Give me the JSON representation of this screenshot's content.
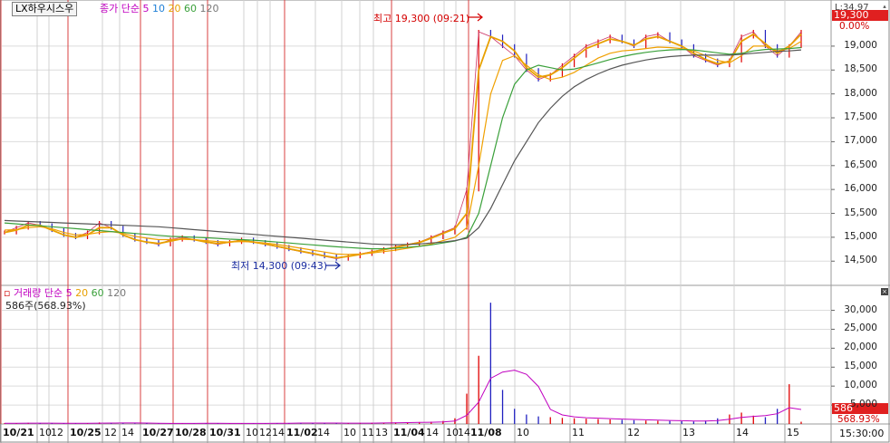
{
  "stock_name": "LX하우시스우",
  "price_legend": {
    "label": "종가 단순",
    "ma": [
      "5",
      "10",
      "20",
      "60",
      "120"
    ]
  },
  "volume_legend": {
    "label": "거래량 단순",
    "ma": [
      "5",
      "20",
      "60",
      "120"
    ],
    "value": "586주(568.93%)"
  },
  "annotations": {
    "high": "최고 19,300 (09:21)",
    "low": "최저 14,300 (09:43)"
  },
  "price_axis": [
    "19,000",
    "18,500",
    "18,000",
    "17,500",
    "17,000",
    "16,500",
    "16,000",
    "15,500",
    "15,000",
    "14,500"
  ],
  "price_axis_top": "L:34.97",
  "price_tag": "19,300",
  "price_change": "0.00%",
  "volume_axis": [
    "30,000",
    "25,000",
    "20,000",
    "15,000",
    "10,000",
    "5,000"
  ],
  "volume_tag": "586",
  "volume_pct": "568.93%",
  "time_label": "15:30:00",
  "dates": [
    {
      "t": "10/21",
      "bold": true
    },
    {
      "t": "10",
      "bold": false
    },
    {
      "t": "12",
      "bold": false
    },
    {
      "t": "10/25",
      "bold": true
    },
    {
      "t": "12",
      "bold": false
    },
    {
      "t": "14",
      "bold": false
    },
    {
      "t": "10/27",
      "bold": true
    },
    {
      "t": "10/28",
      "bold": true
    },
    {
      "t": "10/31",
      "bold": true
    },
    {
      "t": "10",
      "bold": false
    },
    {
      "t": "12",
      "bold": false
    },
    {
      "t": "14",
      "bold": false
    },
    {
      "t": "11/02",
      "bold": true
    },
    {
      "t": "14",
      "bold": false
    },
    {
      "t": "10",
      "bold": false
    },
    {
      "t": "11",
      "bold": false
    },
    {
      "t": "13",
      "bold": false
    },
    {
      "t": "11/04",
      "bold": true
    },
    {
      "t": "14",
      "bold": false
    },
    {
      "t": "10",
      "bold": false
    },
    {
      "t": "14",
      "bold": false
    },
    {
      "t": "11/08",
      "bold": true
    },
    {
      "t": "10",
      "bold": false
    },
    {
      "t": "11",
      "bold": false
    },
    {
      "t": "12",
      "bold": false
    },
    {
      "t": "13",
      "bold": false
    },
    {
      "t": "14",
      "bold": false
    },
    {
      "t": "15",
      "bold": false
    }
  ],
  "colors": {
    "ma5": "#e8a000",
    "ma10": "#1e7fd6",
    "ma20": "#f0a000",
    "ma60": "#3aa03a",
    "ma120": "#555555",
    "legend_ma5": "#c000c0",
    "up": "#e00000",
    "down": "#2020c0",
    "tag": "#e02020",
    "grid_red": "#d84040"
  },
  "chart_data": {
    "type": "line",
    "series": [
      {
        "name": "종가",
        "y": [
          15100,
          15200,
          15300,
          15250,
          15150,
          15050,
          15000,
          15100,
          15300,
          15200,
          15050,
          14950,
          14900,
          14850,
          14950,
          15000,
          14950,
          14900,
          14850,
          14900,
          14950,
          14900,
          14850,
          14800,
          14750,
          14700,
          14650,
          14600,
          14550,
          14600,
          14650,
          14700,
          14750,
          14800,
          14850,
          14900,
          15000,
          15100,
          15200,
          16000,
          19300,
          19200,
          19000,
          18800,
          18500,
          18300,
          18400,
          18600,
          18800,
          19000,
          19100,
          19200,
          19100,
          19000,
          19200,
          19250,
          19100,
          19000,
          18800,
          18700,
          18600,
          18700,
          19200,
          19300,
          19000,
          18800,
          19000,
          19300
        ]
      },
      {
        "name": "5",
        "y": [
          15100,
          15150,
          15250,
          15250,
          15150,
          15050,
          15000,
          15050,
          15200,
          15200,
          15050,
          14950,
          14900,
          14870,
          14920,
          14970,
          14950,
          14900,
          14870,
          14900,
          14930,
          14900,
          14860,
          14810,
          14760,
          14710,
          14660,
          14610,
          14570,
          14600,
          14640,
          14690,
          14740,
          14790,
          14840,
          14890,
          14980,
          15080,
          15180,
          15500,
          18500,
          19200,
          19100,
          18900,
          18550,
          18350,
          18400,
          18550,
          18750,
          18950,
          19050,
          19150,
          19100,
          19020,
          19150,
          19200,
          19100,
          19000,
          18850,
          18720,
          18630,
          18680,
          19100,
          19250,
          19050,
          18850,
          19000,
          19250
        ]
      },
      {
        "name": "20",
        "y": [
          15150,
          15160,
          15200,
          15220,
          15180,
          15100,
          15050,
          15060,
          15100,
          15120,
          15080,
          15020,
          14980,
          14950,
          14950,
          14960,
          14950,
          14930,
          14910,
          14900,
          14910,
          14900,
          14880,
          14850,
          14810,
          14770,
          14730,
          14690,
          14650,
          14640,
          14650,
          14670,
          14700,
          14730,
          14770,
          14810,
          14860,
          14930,
          15000,
          15200,
          16500,
          18000,
          18700,
          18800,
          18600,
          18400,
          18300,
          18350,
          18450,
          18600,
          18750,
          18850,
          18900,
          18920,
          18950,
          18980,
          18970,
          18950,
          18900,
          18800,
          18700,
          18650,
          18800,
          19000,
          19000,
          18900,
          18950,
          19100
        ]
      },
      {
        "name": "60",
        "y": [
          15300,
          15280,
          15260,
          15240,
          15220,
          15200,
          15180,
          15160,
          15140,
          15120,
          15100,
          15080,
          15060,
          15040,
          15020,
          15010,
          15000,
          14990,
          14975,
          14960,
          14950,
          14940,
          14920,
          14900,
          14880,
          14860,
          14840,
          14820,
          14800,
          14785,
          14770,
          14760,
          14760,
          14770,
          14790,
          14810,
          14840,
          14880,
          14920,
          15000,
          15500,
          16500,
          17500,
          18200,
          18500,
          18600,
          18550,
          18500,
          18520,
          18580,
          18650,
          18720,
          18780,
          18830,
          18870,
          18900,
          18920,
          18930,
          18920,
          18890,
          18860,
          18830,
          18850,
          18900,
          18930,
          18940,
          18950,
          18970
        ]
      },
      {
        "name": "120",
        "y": [
          15350,
          15340,
          15330,
          15320,
          15310,
          15300,
          15290,
          15280,
          15270,
          15260,
          15250,
          15240,
          15230,
          15220,
          15200,
          15180,
          15160,
          15140,
          15120,
          15100,
          15080,
          15060,
          15040,
          15020,
          15000,
          14980,
          14960,
          14940,
          14920,
          14900,
          14880,
          14860,
          14850,
          14845,
          14850,
          14860,
          14880,
          14900,
          14930,
          14980,
          15200,
          15600,
          16100,
          16600,
          17000,
          17400,
          17700,
          17950,
          18150,
          18300,
          18420,
          18520,
          18600,
          18660,
          18710,
          18750,
          18780,
          18800,
          18810,
          18810,
          18810,
          18810,
          18830,
          18850,
          18870,
          18890,
          18900,
          18920
        ]
      }
    ],
    "volume": [
      200,
      150,
      300,
      250,
      180,
      120,
      150,
      200,
      400,
      350,
      200,
      150,
      120,
      100,
      150,
      200,
      180,
      150,
      120,
      100,
      150,
      180,
      200,
      220,
      250,
      300,
      250,
      200,
      180,
      200,
      250,
      300,
      350,
      400,
      450,
      500,
      600,
      800,
      1500,
      8000,
      18000,
      32000,
      9000,
      4000,
      2500,
      2000,
      1800,
      1600,
      1500,
      1400,
      1300,
      1200,
      1100,
      1000,
      900,
      850,
      800,
      700,
      650,
      900,
      1500,
      2500,
      3000,
      2200,
      1800,
      4000,
      10500,
      586
    ],
    "ylim": [
      14050,
      19700
    ],
    "volume_ylim": [
      0,
      33000
    ],
    "ma_periods": [
      5,
      10,
      20,
      60,
      120
    ]
  }
}
